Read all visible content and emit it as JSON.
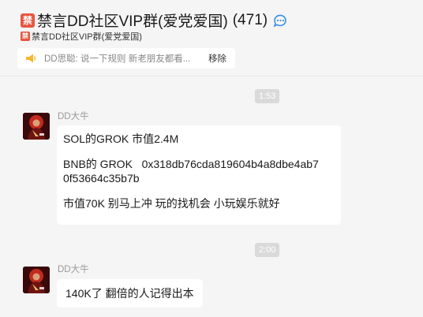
{
  "header": {
    "badge_char": "禁",
    "title": "禁言DD社区VIP群(爱党爱国)",
    "member_count": "(471)",
    "subtitle": "禁言DD社区VIP群(爱党爱国)"
  },
  "notice": {
    "text": "DD思聪: 说一下规则 新老朋友都看...",
    "remove_label": "移除"
  },
  "messages": [
    {
      "time": "1:53",
      "sender": "DD大牛",
      "lines": [
        "SOL的GROK 市值2.4M",
        "",
        "BNB的 GROK   0x318db76cda819604b4a8dbe4ab7",
        "0f53664c35b7b",
        "",
        "市值70K 别马上冲 玩的找机会 小玩娱乐就好"
      ]
    },
    {
      "time": "2:00",
      "sender": "DD大牛",
      "lines": [
        "140K了 翻倍的人记得出本"
      ]
    }
  ],
  "colors": {
    "background": "#f5f5f5",
    "badge": "#e8563f",
    "bubble": "#ffffff",
    "time_pill": "#dadada"
  }
}
